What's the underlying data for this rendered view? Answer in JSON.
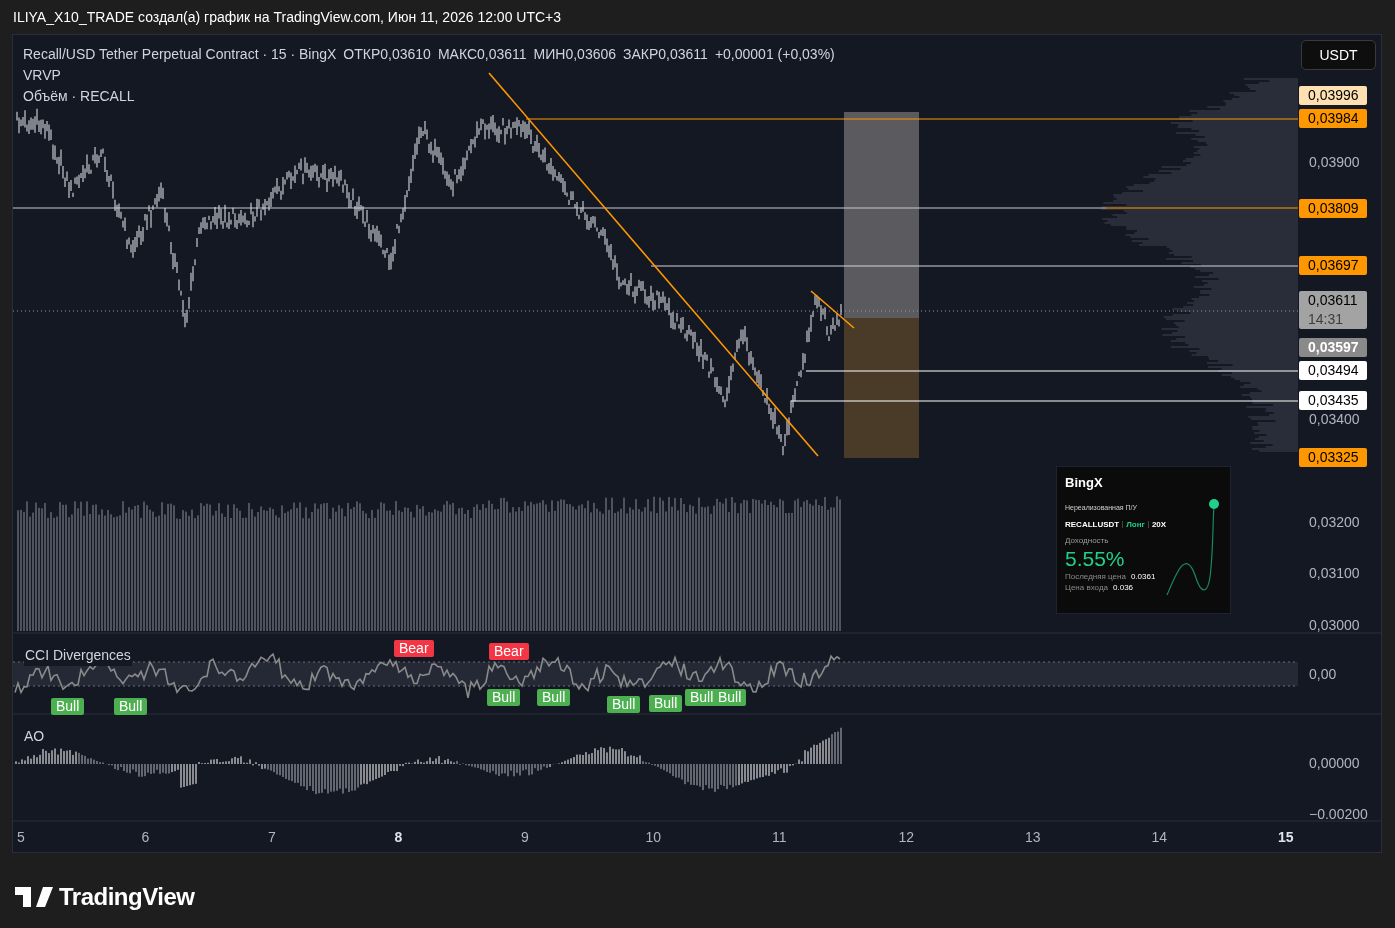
{
  "header": {
    "title": "ILIYA_X10_TRADE создал(а) график на TradingView.com, Июн 11, 2026 12:00 UTC+3"
  },
  "legend": {
    "symbol": "Recall/USD Tether Perpetual Contract · 15 · BingX",
    "ohlc": [
      "ОТКР0,03610",
      "МАКС0,03611",
      "МИН0,03606",
      "ЗАКР0,03611"
    ],
    "change": "+0,00001 (+0,03%)",
    "indicators": [
      "VRVP",
      "Объём · RECALL"
    ]
  },
  "currency_button": "USDT",
  "price_axis": {
    "ticks": [
      "0,03900",
      "0,03400",
      "0,03200",
      "0,03100",
      "0,03000"
    ],
    "labels": [
      {
        "text": "0,03996",
        "kind": "pale"
      },
      {
        "text": "0,03984",
        "kind": "orange"
      },
      {
        "text": "0,03809",
        "kind": "orange"
      },
      {
        "text": "0,03697",
        "kind": "orange"
      },
      {
        "text": "0,03611",
        "kind": "last",
        "time": "14:31"
      },
      {
        "text": "0,03597",
        "kind": "gray"
      },
      {
        "text": "0,03494",
        "kind": "white"
      },
      {
        "text": "0,03435",
        "kind": "white"
      },
      {
        "text": "0,03325",
        "kind": "orange"
      }
    ]
  },
  "card": {
    "brand": "BingX",
    "title": "Нереализованная П/У",
    "symbol": "RECALLUSDT",
    "side": "Лонг",
    "leverage": "20X",
    "return_label": "Доходность",
    "return_value": "5.55%",
    "rows": [
      {
        "label": "Последняя цена",
        "value": "0.0361"
      },
      {
        "label": "Цена входа",
        "value": "0.036"
      }
    ]
  },
  "cci": {
    "title": "CCI Divergences",
    "value": "0,00",
    "signals": [
      {
        "kind": "bear",
        "text": "Bear"
      },
      {
        "kind": "bear",
        "text": "Bear"
      },
      {
        "kind": "bull",
        "text": "Bull"
      },
      {
        "kind": "bull",
        "text": "Bull"
      },
      {
        "kind": "bull",
        "text": "Bull"
      },
      {
        "kind": "bull",
        "text": "Bull"
      },
      {
        "kind": "bull",
        "text": "Bull"
      },
      {
        "kind": "bull",
        "text": "Bull"
      },
      {
        "kind": "bull",
        "text": "Bull"
      },
      {
        "kind": "bull",
        "text": "Bull"
      }
    ]
  },
  "ao": {
    "title": "AO",
    "ticks": [
      "0,00000",
      "−0.00200"
    ]
  },
  "time_axis": [
    {
      "text": "5",
      "bold": false
    },
    {
      "text": "6",
      "bold": false
    },
    {
      "text": "7",
      "bold": false
    },
    {
      "text": "8",
      "bold": true
    },
    {
      "text": "9",
      "bold": false
    },
    {
      "text": "10",
      "bold": false
    },
    {
      "text": "11",
      "bold": false
    },
    {
      "text": "12",
      "bold": false
    },
    {
      "text": "13",
      "bold": false
    },
    {
      "text": "14",
      "bold": false
    },
    {
      "text": "15",
      "bold": true
    }
  ],
  "footer": {
    "logo": "TradingView"
  }
}
